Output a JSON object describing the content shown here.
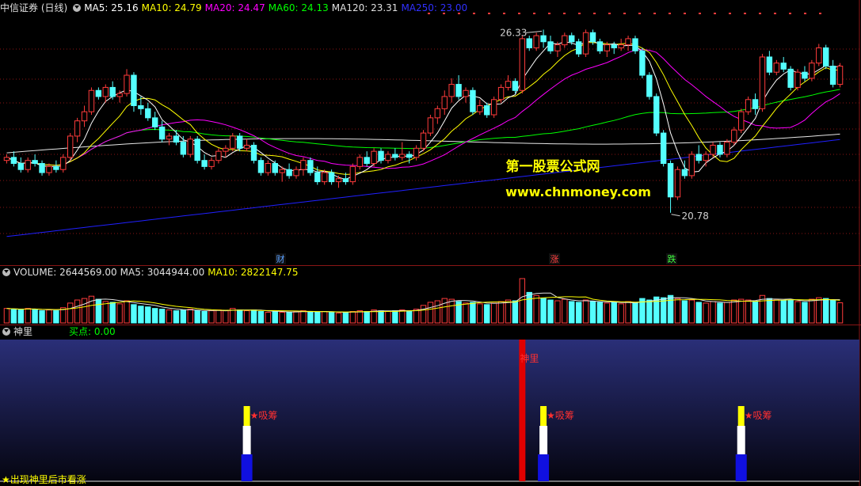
{
  "header": {
    "title": "中信证券 (日线)",
    "ma5": "MA5: 25.16",
    "ma10": "MA10: 24.79",
    "ma20": "MA20: 24.47",
    "ma60": "MA60: 24.13",
    "ma120": "MA120: 23.31",
    "ma250": "MA250: 23.00"
  },
  "colors": {
    "up": "#ff3b3b",
    "down": "#54ffff",
    "ma5": "#ffffff",
    "ma10": "#ffff00",
    "ma20": "#ff00ff",
    "ma60": "#00ff00",
    "ma120": "#e6e6e6",
    "ma250": "#2020ff",
    "grid": "#8a1515"
  },
  "price_labels": {
    "high": "26.33",
    "low": "20.78"
  },
  "watermark": {
    "line1": "第一股票公式网",
    "line2": "www.chnmoney.com"
  },
  "event_markers": [
    {
      "label": "财",
      "color": "#5aa0ff"
    },
    {
      "label": "涨",
      "color": "#ff4040"
    },
    {
      "label": "跌",
      "color": "#40ff40"
    }
  ],
  "volume_header": {
    "volume": "VOLUME: 2644569.00",
    "ma5": "MA5: 3044944.00",
    "ma10": "MA10: 2822147.75"
  },
  "indicator_header": {
    "name": "神里",
    "buy_point": "买点: 0.00"
  },
  "indicator": {
    "signal_label": "神里",
    "absorb_label": "★吸筹",
    "footer_note": "★出现神里后市看涨"
  },
  "chart_data": {
    "type": "candlestick",
    "series": [
      {
        "name": "price",
        "ohlc": [
          [
            22.5,
            22.7,
            22.4,
            22.6
          ],
          [
            22.6,
            22.8,
            22.3,
            22.4
          ],
          [
            22.4,
            22.6,
            22.1,
            22.2
          ],
          [
            22.2,
            22.6,
            22.1,
            22.5
          ],
          [
            22.5,
            22.7,
            22.3,
            22.4
          ],
          [
            22.4,
            22.5,
            22.0,
            22.1
          ],
          [
            22.1,
            22.4,
            22.0,
            22.3
          ],
          [
            22.3,
            22.5,
            22.1,
            22.2
          ],
          [
            22.2,
            22.7,
            22.1,
            22.6
          ],
          [
            22.6,
            23.4,
            22.5,
            23.3
          ],
          [
            23.3,
            23.9,
            23.1,
            23.8
          ],
          [
            23.8,
            24.3,
            23.6,
            24.1
          ],
          [
            24.1,
            24.9,
            24.0,
            24.8
          ],
          [
            24.8,
            24.9,
            24.5,
            24.6
          ],
          [
            24.6,
            25.0,
            24.4,
            24.9
          ],
          [
            24.9,
            25.1,
            24.5,
            24.6
          ],
          [
            24.6,
            24.8,
            24.4,
            24.7
          ],
          [
            24.7,
            25.5,
            24.6,
            25.3
          ],
          [
            25.3,
            25.4,
            24.1,
            24.3
          ],
          [
            24.3,
            24.6,
            24.0,
            24.2
          ],
          [
            24.2,
            24.4,
            23.8,
            23.9
          ],
          [
            23.9,
            24.1,
            23.5,
            23.6
          ],
          [
            23.6,
            23.8,
            23.1,
            23.2
          ],
          [
            23.2,
            23.4,
            23.0,
            23.3
          ],
          [
            23.3,
            23.5,
            23.0,
            23.1
          ],
          [
            23.1,
            23.3,
            22.6,
            22.7
          ],
          [
            22.7,
            23.3,
            22.6,
            23.2
          ],
          [
            23.2,
            23.3,
            22.4,
            22.5
          ],
          [
            22.5,
            22.7,
            22.2,
            22.3
          ],
          [
            22.3,
            22.6,
            22.2,
            22.5
          ],
          [
            22.5,
            22.9,
            22.4,
            22.8
          ],
          [
            22.8,
            23.0,
            22.6,
            22.9
          ],
          [
            22.9,
            23.4,
            22.8,
            23.3
          ],
          [
            23.3,
            23.4,
            22.8,
            22.9
          ],
          [
            22.9,
            23.2,
            22.8,
            23.0
          ],
          [
            23.0,
            23.1,
            22.4,
            22.5
          ],
          [
            22.5,
            22.6,
            22.0,
            22.1
          ],
          [
            22.1,
            22.5,
            22.0,
            22.4
          ],
          [
            22.4,
            22.5,
            22.0,
            22.1
          ],
          [
            22.1,
            22.3,
            21.8,
            22.2
          ],
          [
            22.2,
            22.4,
            21.9,
            22.0
          ],
          [
            22.0,
            22.3,
            21.9,
            22.2
          ],
          [
            22.2,
            22.6,
            22.0,
            22.5
          ],
          [
            22.5,
            22.6,
            22.0,
            22.1
          ],
          [
            22.1,
            22.3,
            21.7,
            21.8
          ],
          [
            21.8,
            22.2,
            21.7,
            22.1
          ],
          [
            22.1,
            22.2,
            21.7,
            21.8
          ],
          [
            21.8,
            22.0,
            21.6,
            21.9
          ],
          [
            21.9,
            22.1,
            21.7,
            21.8
          ],
          [
            21.8,
            22.4,
            21.7,
            22.3
          ],
          [
            22.3,
            22.7,
            22.2,
            22.6
          ],
          [
            22.6,
            22.8,
            22.3,
            22.4
          ],
          [
            22.4,
            22.9,
            22.3,
            22.8
          ],
          [
            22.8,
            22.9,
            22.4,
            22.5
          ],
          [
            22.5,
            22.8,
            22.4,
            22.7
          ],
          [
            22.7,
            22.9,
            22.5,
            22.6
          ],
          [
            22.6,
            23.1,
            22.5,
            22.7
          ],
          [
            22.7,
            22.8,
            22.4,
            22.6
          ],
          [
            22.6,
            23.0,
            22.5,
            22.9
          ],
          [
            22.9,
            23.5,
            22.8,
            23.4
          ],
          [
            23.4,
            24.0,
            23.3,
            23.9
          ],
          [
            23.9,
            24.3,
            23.7,
            24.2
          ],
          [
            24.2,
            24.8,
            24.0,
            24.6
          ],
          [
            24.6,
            25.2,
            24.4,
            25.0
          ],
          [
            25.0,
            25.3,
            24.5,
            24.6
          ],
          [
            24.6,
            24.9,
            24.4,
            24.8
          ],
          [
            24.8,
            24.9,
            24.0,
            24.1
          ],
          [
            24.1,
            24.5,
            24.0,
            24.3
          ],
          [
            24.3,
            24.4,
            23.9,
            24.0
          ],
          [
            24.0,
            24.6,
            23.9,
            24.5
          ],
          [
            24.5,
            25.0,
            24.4,
            24.9
          ],
          [
            24.9,
            25.3,
            24.8,
            25.1
          ],
          [
            25.1,
            25.2,
            24.7,
            24.8
          ],
          [
            24.8,
            26.6,
            24.7,
            26.5
          ],
          [
            26.5,
            26.6,
            26.1,
            26.2
          ],
          [
            26.2,
            26.7,
            26.1,
            26.6
          ],
          [
            26.6,
            26.8,
            26.2,
            26.4
          ],
          [
            26.4,
            26.6,
            26.0,
            26.1
          ],
          [
            26.1,
            26.4,
            25.9,
            26.3
          ],
          [
            26.3,
            26.7,
            26.2,
            26.6
          ],
          [
            26.6,
            26.7,
            26.3,
            26.4
          ],
          [
            26.4,
            26.5,
            25.9,
            26.0
          ],
          [
            26.0,
            26.8,
            25.9,
            26.7
          ],
          [
            26.7,
            26.8,
            26.3,
            26.4
          ],
          [
            26.4,
            26.5,
            26.0,
            26.1
          ],
          [
            26.1,
            26.4,
            25.9,
            26.3
          ],
          [
            26.3,
            26.4,
            26.0,
            26.2
          ],
          [
            26.2,
            26.5,
            26.1,
            26.3
          ],
          [
            26.3,
            26.6,
            26.1,
            26.5
          ],
          [
            26.5,
            26.6,
            26.0,
            26.1
          ],
          [
            26.1,
            26.2,
            25.2,
            25.3
          ],
          [
            25.3,
            25.4,
            24.5,
            24.6
          ],
          [
            24.6,
            24.7,
            23.3,
            23.4
          ],
          [
            23.4,
            23.5,
            22.3,
            22.4
          ],
          [
            22.4,
            22.5,
            20.78,
            21.3
          ],
          [
            21.3,
            22.3,
            21.2,
            22.2
          ],
          [
            22.2,
            22.5,
            21.9,
            22.0
          ],
          [
            22.0,
            22.8,
            21.9,
            22.7
          ],
          [
            22.7,
            23.0,
            22.4,
            22.5
          ],
          [
            22.5,
            22.8,
            22.3,
            22.7
          ],
          [
            22.7,
            23.1,
            22.6,
            23.0
          ],
          [
            23.0,
            23.1,
            22.6,
            22.7
          ],
          [
            22.7,
            23.2,
            22.6,
            23.1
          ],
          [
            23.1,
            23.6,
            23.0,
            23.5
          ],
          [
            23.5,
            24.2,
            23.4,
            24.1
          ],
          [
            24.1,
            24.6,
            24.0,
            24.5
          ],
          [
            24.5,
            24.7,
            24.0,
            24.2
          ],
          [
            24.2,
            26.0,
            24.1,
            25.9
          ],
          [
            25.9,
            26.1,
            25.3,
            25.4
          ],
          [
            25.4,
            25.8,
            25.3,
            25.7
          ],
          [
            25.7,
            25.9,
            25.4,
            25.5
          ],
          [
            25.5,
            25.6,
            24.8,
            24.9
          ],
          [
            24.9,
            25.5,
            24.8,
            25.4
          ],
          [
            25.4,
            25.6,
            25.1,
            25.2
          ],
          [
            25.2,
            25.8,
            25.1,
            25.7
          ],
          [
            25.7,
            26.33,
            25.6,
            26.2
          ],
          [
            26.2,
            26.3,
            25.5,
            25.6
          ],
          [
            25.6,
            25.8,
            24.9,
            25.0
          ],
          [
            25.0,
            25.7,
            24.9,
            25.6
          ]
        ]
      },
      {
        "name": "VOLUME",
        "values": [
          1.9,
          1.8,
          1.7,
          1.9,
          1.8,
          1.6,
          1.7,
          1.6,
          2.0,
          2.6,
          3.0,
          3.2,
          3.5,
          3.1,
          2.8,
          2.7,
          2.5,
          2.9,
          2.4,
          2.2,
          2.1,
          1.9,
          1.8,
          1.7,
          1.6,
          1.7,
          1.8,
          1.6,
          1.5,
          1.6,
          1.7,
          1.6,
          1.9,
          1.7,
          1.6,
          1.7,
          1.5,
          1.4,
          1.5,
          1.4,
          1.4,
          1.5,
          1.6,
          1.5,
          1.4,
          1.5,
          1.4,
          1.3,
          1.4,
          1.5,
          1.6,
          1.5,
          1.7,
          1.6,
          1.5,
          1.6,
          1.7,
          1.6,
          1.8,
          2.3,
          2.7,
          2.9,
          3.2,
          3.1,
          2.8,
          2.6,
          2.7,
          2.5,
          2.4,
          2.6,
          2.8,
          3.0,
          2.9,
          5.8,
          4.0,
          3.6,
          3.2,
          3.0,
          2.9,
          3.1,
          2.8,
          2.7,
          3.0,
          2.8,
          2.7,
          2.6,
          2.7,
          2.5,
          2.8,
          2.6,
          3.2,
          3.0,
          3.4,
          3.3,
          3.6,
          3.2,
          2.9,
          3.0,
          2.7,
          2.6,
          2.8,
          2.6,
          2.7,
          3.0,
          3.1,
          3.0,
          2.8,
          3.6,
          3.2,
          3.0,
          2.9,
          3.0,
          2.8,
          2.7,
          3.1,
          3.3,
          3.2,
          3.0,
          2.64
        ]
      }
    ],
    "ylim": [
      19.5,
      27.2
    ],
    "volume_unit": "million",
    "signal_bar_index": 73,
    "absorb_bar_indices": [
      34,
      76,
      104
    ],
    "grid": true,
    "legend": "top-left"
  }
}
